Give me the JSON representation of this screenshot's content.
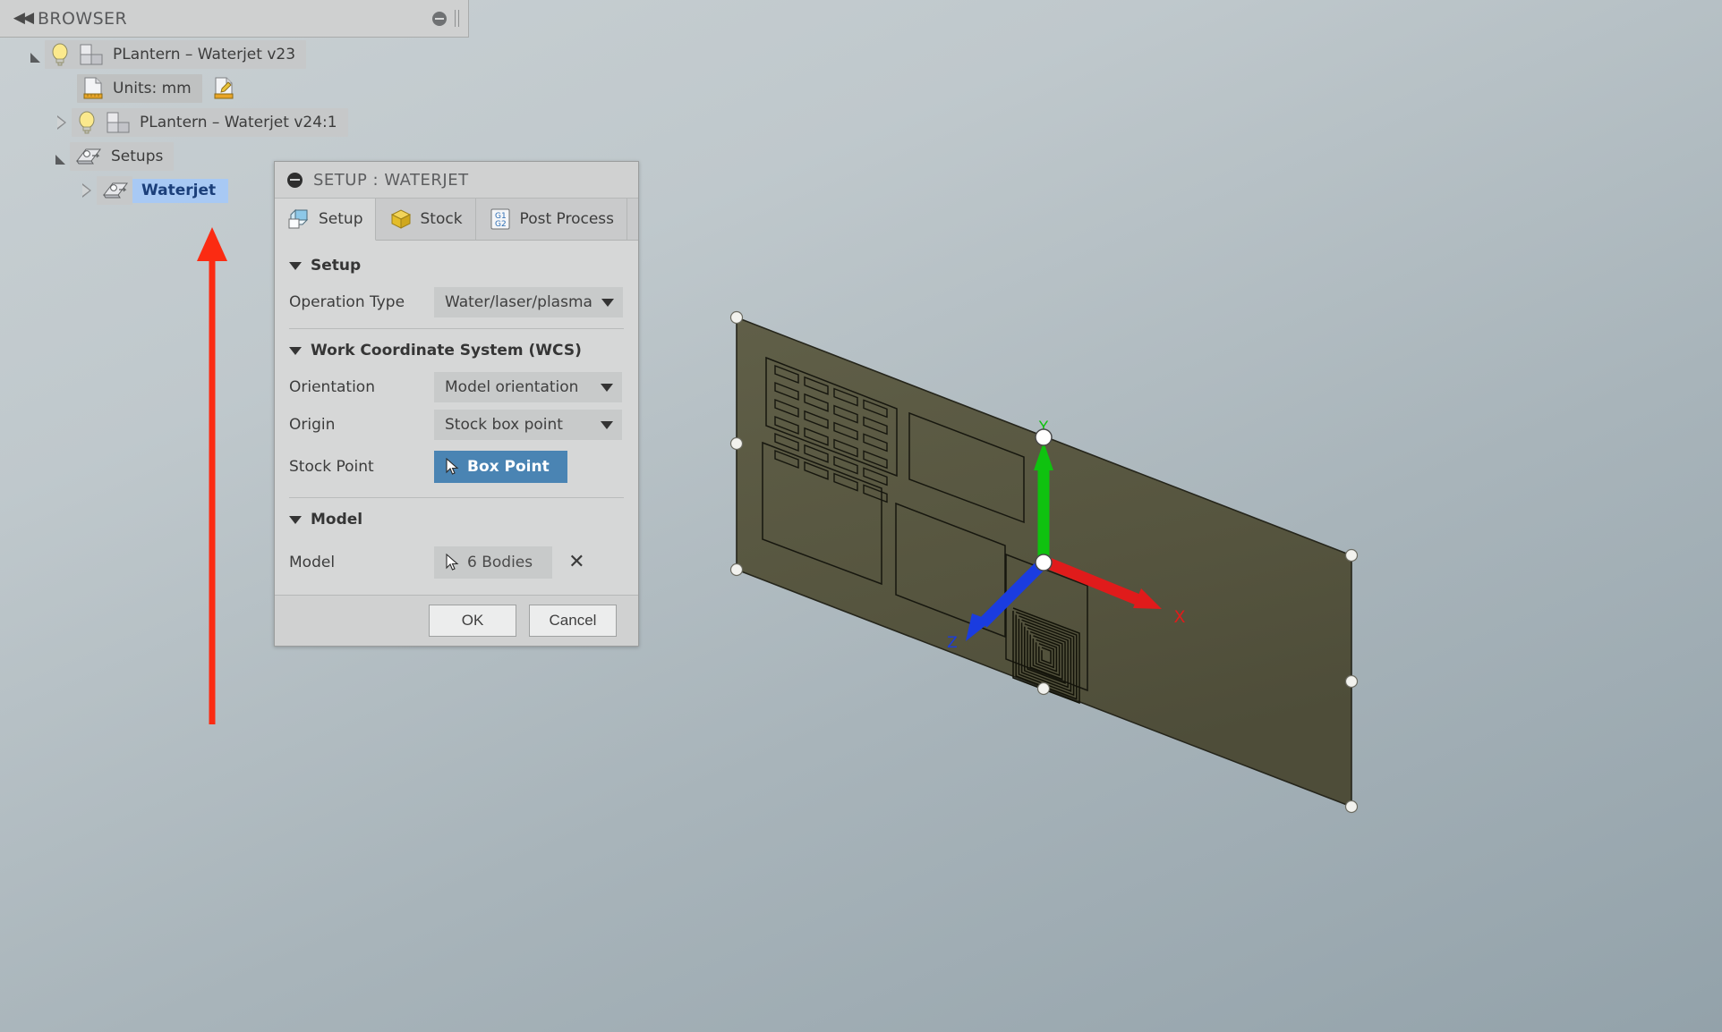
{
  "browser": {
    "title": "BROWSER",
    "collapse_icon": "double-left-chevron-icon",
    "tree": [
      {
        "id": "root",
        "label": "PLantern – Waterjet v23",
        "depth": 0,
        "twisty": "open",
        "icons": [
          "lightbulb-icon",
          "component-icon"
        ],
        "selected": false
      },
      {
        "id": "units",
        "label": "Units: mm",
        "depth": 1,
        "twisty": "none",
        "icons": [
          "document-ruler-icon"
        ],
        "trailing_icon": "document-edit-icon",
        "selected": false
      },
      {
        "id": "occurrence",
        "label": "PLantern – Waterjet v24:1",
        "depth": 1,
        "twisty": "closed",
        "icons": [
          "lightbulb-icon",
          "component-icon"
        ],
        "selected": false
      },
      {
        "id": "setups",
        "label": "Setups",
        "depth": 1,
        "twisty": "open",
        "icons": [
          "setup-folder-icon"
        ],
        "selected": false
      },
      {
        "id": "waterjet",
        "label": "Waterjet",
        "depth": 2,
        "twisty": "closed",
        "icons": [
          "setup-folder-icon"
        ],
        "selected": true
      }
    ]
  },
  "dialog": {
    "title": "SETUP : WATERJET",
    "collapse_icon": "minus-circle-icon",
    "tabs": [
      {
        "label": "Setup",
        "icon": "setup-cube-icon",
        "active": true
      },
      {
        "label": "Stock",
        "icon": "stock-box-icon",
        "active": false
      },
      {
        "label": "Post Process",
        "icon": "g-code-icon",
        "active": false
      }
    ],
    "sections": [
      {
        "title": "Setup",
        "expanded": true,
        "fields": [
          {
            "label": "Operation Type",
            "type": "combo",
            "value": "Water/laser/plasma"
          }
        ]
      },
      {
        "title": "Work Coordinate System (WCS)",
        "expanded": true,
        "fields": [
          {
            "label": "Orientation",
            "type": "combo",
            "value": "Model orientation"
          },
          {
            "label": "Origin",
            "type": "combo",
            "value": "Stock box point"
          },
          {
            "label": "Stock Point",
            "type": "select-button",
            "value": "Box Point",
            "state": "active"
          }
        ]
      },
      {
        "title": "Model",
        "expanded": true,
        "fields": [
          {
            "label": "Model",
            "type": "select-button",
            "value": "6 Bodies",
            "state": "normal",
            "clear_icon": "x-clear-icon"
          }
        ]
      }
    ],
    "buttons": {
      "ok": "OK",
      "cancel": "Cancel"
    }
  },
  "viewport": {
    "axes": [
      {
        "name": "X",
        "color": "#e01b1b",
        "label": "X"
      },
      {
        "name": "Y",
        "color": "#0fc20f",
        "label": "Y"
      },
      {
        "name": "Z",
        "color": "#1a3ce0",
        "label": "Z"
      }
    ],
    "model_color": "#585741",
    "background_top": "#c9d0d3",
    "background_bottom": "#93a2aa",
    "selected_body_handles": 8
  },
  "annotation": {
    "arrow_color": "#fb2b12",
    "points_to": "Waterjet"
  }
}
